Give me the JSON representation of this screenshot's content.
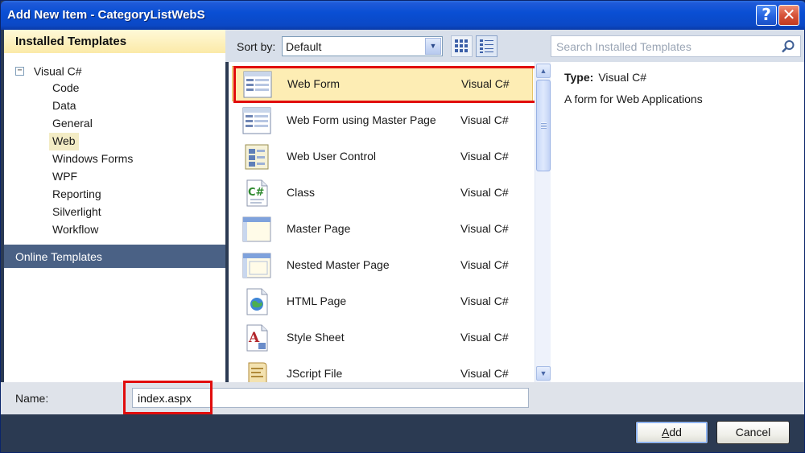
{
  "window": {
    "title": "Add New Item - CategoryListWebS"
  },
  "title_buttons": {
    "help": "?",
    "close": "✕"
  },
  "left_panel": {
    "installed_header": "Installed Templates",
    "tree_root": {
      "label": "Visual C#",
      "expander": "−"
    },
    "tree_children": [
      "Code",
      "Data",
      "General",
      "Web",
      "Windows Forms",
      "WPF",
      "Reporting",
      "Silverlight",
      "Workflow"
    ],
    "selected_child": "Web",
    "online_templates": "Online Templates"
  },
  "toolbar": {
    "sort_label": "Sort by:",
    "sort_value": "Default",
    "dropdown_arrow": "▼",
    "view_buttons": [
      "medium-icons-view",
      "list-view"
    ]
  },
  "templates": [
    {
      "name": "Web Form",
      "language": "Visual C#",
      "icon": "web-form-icon",
      "selected": true
    },
    {
      "name": "Web Form using Master Page",
      "language": "Visual C#",
      "icon": "web-form-master-icon"
    },
    {
      "name": "Web User Control",
      "language": "Visual C#",
      "icon": "web-user-control-icon"
    },
    {
      "name": "Class",
      "language": "Visual C#",
      "icon": "csharp-class-icon"
    },
    {
      "name": "Master Page",
      "language": "Visual C#",
      "icon": "master-page-icon"
    },
    {
      "name": "Nested Master Page",
      "language": "Visual C#",
      "icon": "nested-master-page-icon"
    },
    {
      "name": "HTML Page",
      "language": "Visual C#",
      "icon": "html-page-icon"
    },
    {
      "name": "Style Sheet",
      "language": "Visual C#",
      "icon": "style-sheet-icon"
    },
    {
      "name": "JScript File",
      "language": "Visual C#",
      "icon": "jscript-file-icon"
    }
  ],
  "scrollbar": {
    "up": "▲",
    "down": "▼"
  },
  "search": {
    "placeholder": "Search Installed Templates"
  },
  "details": {
    "type_label": "Type:",
    "type_value": "Visual C#",
    "description": "A form for Web Applications"
  },
  "name_field": {
    "label": "Name:",
    "value": "index.aspx"
  },
  "buttons": {
    "add_mnemonic": "A",
    "add_rest": "dd",
    "cancel": "Cancel"
  },
  "colors": {
    "titlebar": "#0a4fd4",
    "highlight": "#e10d0d",
    "selected_row": "#fdedb4",
    "online_templates_bg": "#4a6185"
  }
}
